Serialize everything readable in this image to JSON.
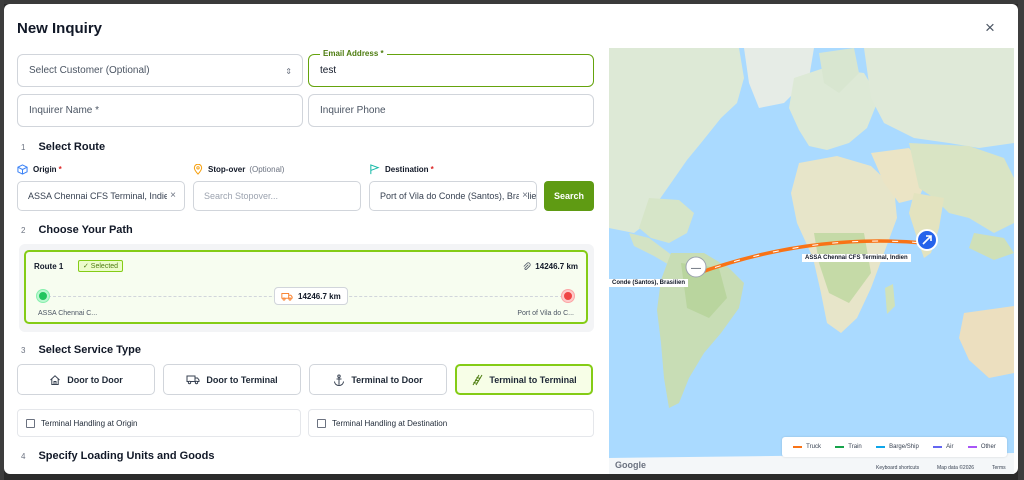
{
  "dialog": {
    "title": "New Inquiry",
    "close_label": "×"
  },
  "form": {
    "customer_placeholder": "Select Customer (Optional)",
    "email_label": "Email Address",
    "email_value": "test",
    "inquirer_name_placeholder": "Inquirer Name *",
    "inquirer_phone_placeholder": "Inquirer Phone"
  },
  "steps": [
    {
      "num": "1",
      "title": "Select Route"
    },
    {
      "num": "2",
      "title": "Choose Your Path"
    },
    {
      "num": "3",
      "title": "Select Service Type"
    },
    {
      "num": "4",
      "title": "Specify Loading Units and Goods"
    }
  ],
  "route": {
    "origin_label": "Origin",
    "origin_value": "ASSA Chennai CFS Terminal, Indien",
    "stopover_label": "Stop-over",
    "stopover_optional": "(Optional)",
    "stopover_placeholder": "Search Stopover...",
    "destination_label": "Destination",
    "destination_value": "Port of Vila do Conde (Santos), Brasilien",
    "clear_label": "×",
    "search_label": "Search"
  },
  "path": {
    "route_title": "Route 1",
    "selected_badge": "✓ Selected",
    "total_distance": "14246.7 km",
    "leg_distance": "14246.7 km",
    "start_label": "ASSA Chennai C...",
    "end_label": "Port of Vila do C..."
  },
  "service_types": [
    {
      "label": "Door to Door",
      "icon": "home-icon",
      "selected": false
    },
    {
      "label": "Door to Terminal",
      "icon": "truck-icon",
      "selected": false
    },
    {
      "label": "Terminal to Door",
      "icon": "anchor-icon",
      "selected": false
    },
    {
      "label": "Terminal to Terminal",
      "icon": "rail-icon",
      "selected": true
    }
  ],
  "handling": {
    "origin_label": "Terminal Handling at Origin",
    "destination_label": "Terminal Handling at Destination"
  },
  "map": {
    "origin_marker_label": "ASSA Chennai CFS Terminal, Indien",
    "destination_marker_label": "Conde (Santos), Brasilien",
    "legend": [
      {
        "label": "Truck",
        "color": "#f97316"
      },
      {
        "label": "Train",
        "color": "#16a34a"
      },
      {
        "label": "Barge/Ship",
        "color": "#0ea5e9"
      },
      {
        "label": "Air",
        "color": "#6366f1"
      },
      {
        "label": "Other",
        "color": "#a855f7"
      }
    ],
    "google_label": "Google",
    "keyboard_shortcuts": "Keyboard shortcuts",
    "map_data": "Map data ©2026",
    "terms": "Terms"
  },
  "colors": {
    "accent": "#5f9b13",
    "accent_light": "#84cc16",
    "route_line": "#f97316",
    "water": "#aadaff"
  }
}
